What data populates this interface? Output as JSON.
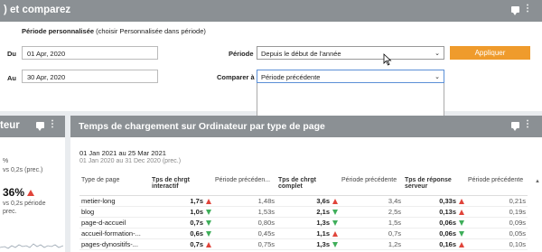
{
  "top": {
    "title": ") et comparez",
    "custom_period_label": "Période personnalisée",
    "custom_period_hint": "(choisir Personnalisée dans période)",
    "du_label": "Du",
    "du_value": "01 Apr, 2020",
    "au_label": "Au",
    "au_value": "30 Apr, 2020",
    "periode_label": "Période",
    "periode_value": "Depuis le début de l'année",
    "comparer_label": "Comparer à",
    "comparer_value": "Période précédente",
    "apply_label": "Appliquer"
  },
  "left": {
    "title": "teur",
    "line1": "%",
    "line2": "vs 0,2s (prec.)",
    "big_value": "36%",
    "line3": "vs 0,2s période",
    "line4": "prec."
  },
  "main": {
    "title": "Temps de chargement sur Ordinateur par type de page",
    "date_range": "01 Jan 2021 au 25 Mar 2021",
    "date_range_prev": "01 Jan 2020 au 31 Dec 2020 (prec.)",
    "columns": [
      "Type de page",
      "Tps de chrgt interactif",
      "Période précéden...",
      "Tps de chrgt complet",
      "Période précédente",
      "Tps de réponse serveur",
      "Période précédente"
    ],
    "rows": [
      {
        "page": "metier-long",
        "interactif": "1,7s",
        "i_dir": "up",
        "prev1": "1,48s",
        "complet": "3,6s",
        "c_dir": "up",
        "prev2": "3,4s",
        "serveur": "0,33s",
        "s_dir": "up",
        "prev3": "0,21s"
      },
      {
        "page": "blog",
        "interactif": "1,0s",
        "i_dir": "down",
        "prev1": "1,53s",
        "complet": "2,1s",
        "c_dir": "down",
        "prev2": "2,5s",
        "serveur": "0,13s",
        "s_dir": "up",
        "prev3": "0,19s"
      },
      {
        "page": "page-d-accueil",
        "interactif": "0,7s",
        "i_dir": "down",
        "prev1": "0,80s",
        "complet": "1,3s",
        "c_dir": "down",
        "prev2": "1,5s",
        "serveur": "0,06s",
        "s_dir": "down",
        "prev3": "0,09s"
      },
      {
        "page": "accueil-formation-...",
        "interactif": "0,6s",
        "i_dir": "down",
        "prev1": "0,45s",
        "complet": "1,1s",
        "c_dir": "up",
        "prev2": "0,7s",
        "serveur": "0,06s",
        "s_dir": "down",
        "prev3": "0,05s"
      },
      {
        "page": "pages-dynositifs-...",
        "interactif": "0,7s",
        "i_dir": "up",
        "prev1": "0,75s",
        "complet": "1,3s",
        "c_dir": "down",
        "prev2": "1,2s",
        "serveur": "0,16s",
        "s_dir": "up",
        "prev3": "0,10s"
      }
    ]
  }
}
